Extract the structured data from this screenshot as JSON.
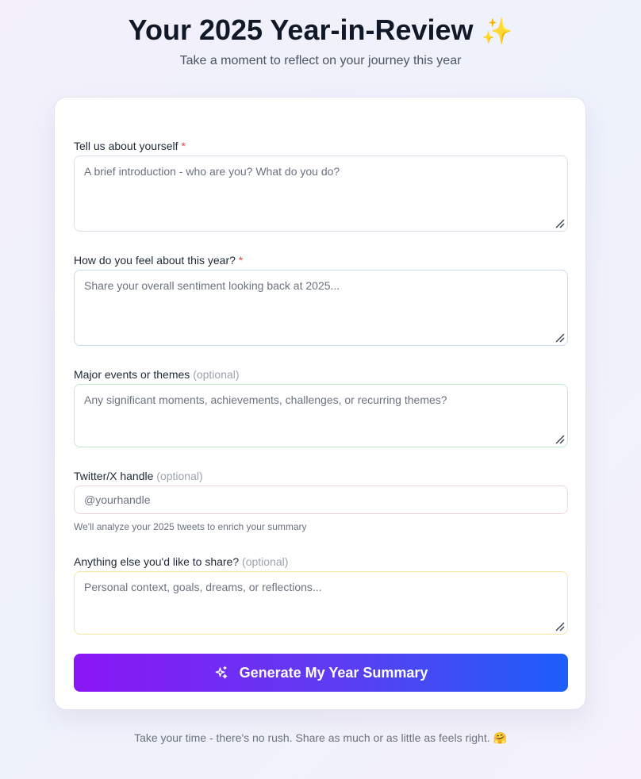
{
  "header": {
    "title": "Your 2025 Year-in-Review",
    "title_emoji": "✨",
    "subtitle": "Take a moment to reflect on your journey this year"
  },
  "form": {
    "about": {
      "label": "Tell us about yourself",
      "required_mark": "*",
      "placeholder": "A brief introduction - who are you? What do you do?",
      "value": ""
    },
    "feeling": {
      "label": "How do you feel about this year?",
      "required_mark": "*",
      "placeholder": "Share your overall sentiment looking back at 2025...",
      "value": ""
    },
    "events": {
      "label": "Major events or themes",
      "optional_text": "(optional)",
      "placeholder": "Any significant moments, achievements, challenges, or recurring themes?",
      "value": ""
    },
    "twitter": {
      "label": "Twitter/X handle",
      "optional_text": "(optional)",
      "placeholder": "@yourhandle",
      "value": "",
      "hint": "We'll analyze your 2025 tweets to enrich your summary"
    },
    "extra": {
      "label": "Anything else you'd like to share?",
      "optional_text": "(optional)",
      "placeholder": "Personal context, goals, dreams, or reflections...",
      "value": ""
    },
    "submit": {
      "label": "Generate My Year Summary",
      "icon": "sparkles-icon"
    }
  },
  "footer": {
    "text": "Take your time - there's no rush. Share as much or as little as feels right.",
    "emoji": "🤗"
  },
  "colors": {
    "required": "#ef4444",
    "button_gradient_start": "#8b16f5",
    "button_gradient_end": "#1d5ef9"
  }
}
